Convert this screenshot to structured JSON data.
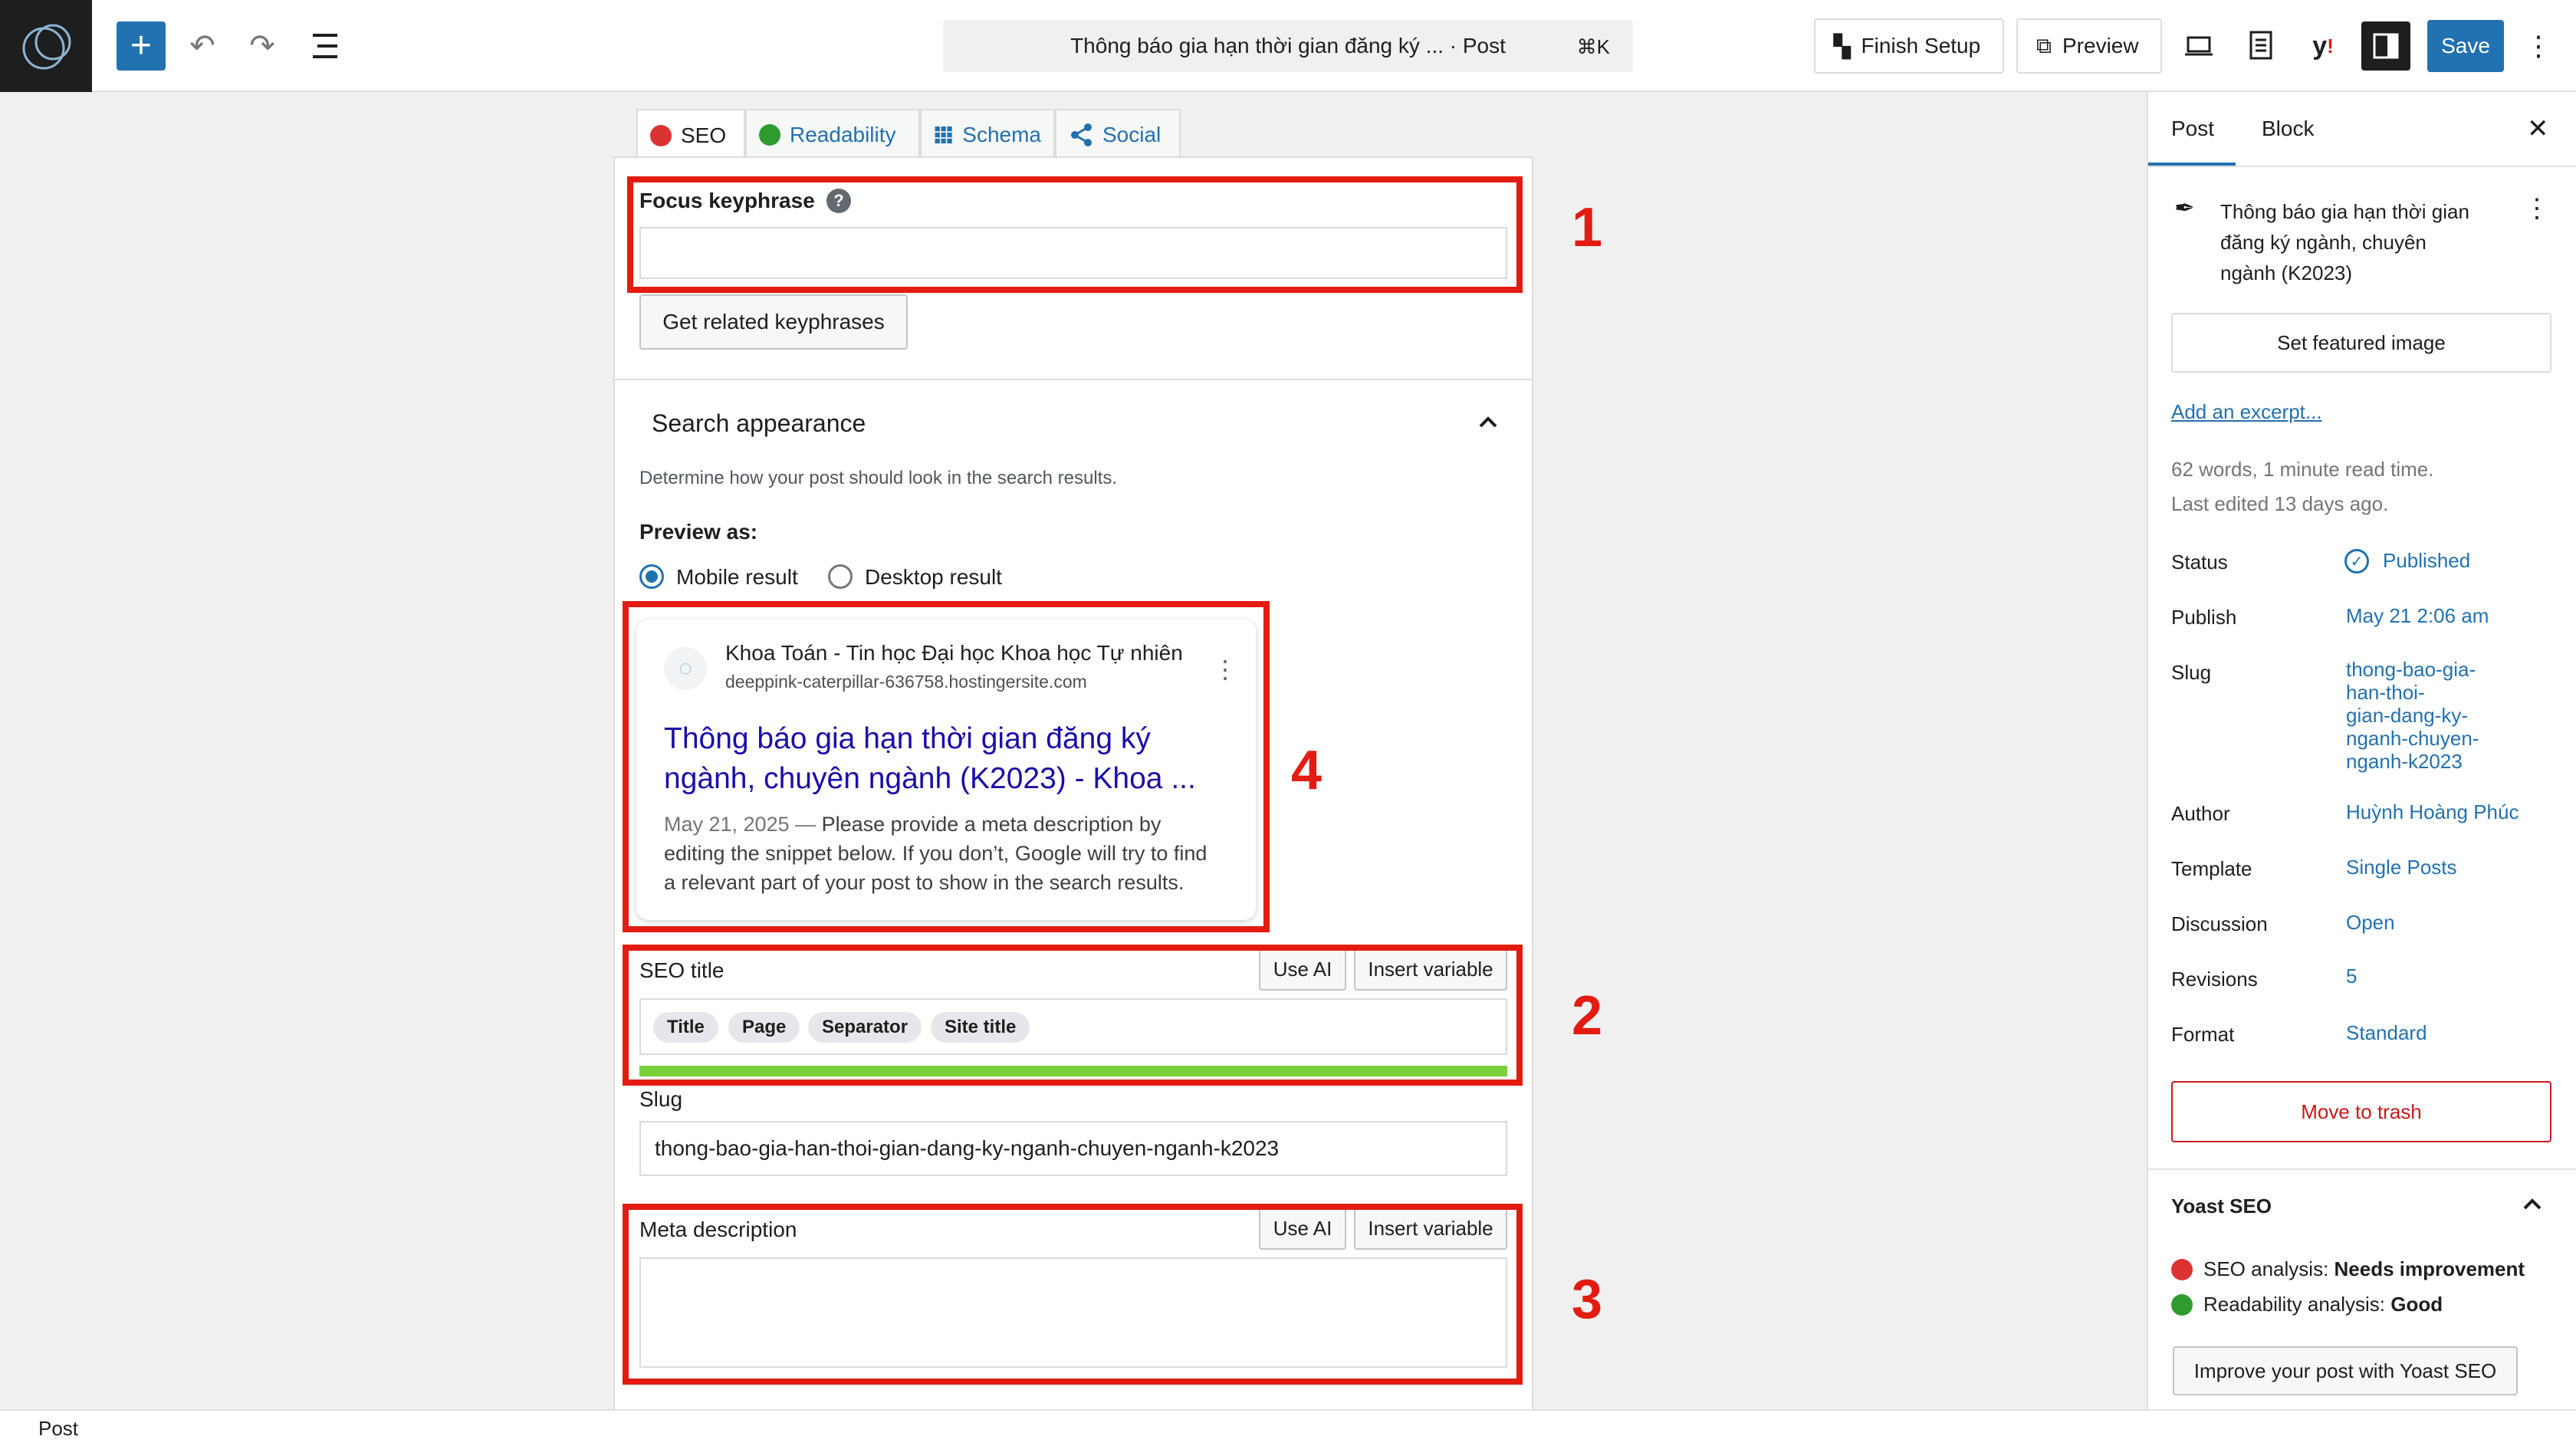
{
  "topbar": {
    "command_title": "Thông báo gia hạn thời gian đăng ký ... · Post",
    "shortcut": "⌘K",
    "finish_setup": "Finish Setup",
    "preview": "Preview",
    "save": "Save"
  },
  "tabs": [
    {
      "label": "SEO"
    },
    {
      "label": "Readability"
    },
    {
      "label": "Schema"
    },
    {
      "label": "Social"
    }
  ],
  "seo": {
    "focus_keyphrase_label": "Focus keyphrase",
    "related_btn": "Get related keyphrases",
    "search_appearance": "Search appearance",
    "search_appearance_desc": "Determine how your post should look in the search results.",
    "preview_as": "Preview as:",
    "mobile_result": "Mobile result",
    "desktop_result": "Desktop result",
    "snippet": {
      "site_name": "Khoa Toán - Tin học Đại học Khoa học Tự nhiên",
      "site_url": "deeppink-caterpillar-636758.hostingersite.com",
      "title_line1": "Thông báo gia hạn thời gian đăng ký",
      "title_line2": "ngành, chuyên ngành (K2023) - Khoa ...",
      "date": "May 21, 2025",
      "desc_line1": "Please provide a meta description by",
      "desc_line2": "editing the snippet below. If you don’t, Google will try to find",
      "desc_line3": "a relevant part of your post to show in the search results."
    },
    "seo_title_label": "SEO title",
    "use_ai": "Use AI",
    "insert_variable": "Insert variable",
    "pills": [
      "Title",
      "Page",
      "Separator",
      "Site title"
    ],
    "slug_label": "Slug",
    "slug_value": "thong-bao-gia-han-thoi-gian-dang-ky-nganh-chuyen-nganh-k2023",
    "meta_description_label": "Meta description"
  },
  "annotations": [
    "1",
    "2",
    "3",
    "4"
  ],
  "sidebar": {
    "tab_post": "Post",
    "tab_block": "Block",
    "post_title_line1": "Thông báo gia hạn thời gian",
    "post_title_line2": "đăng ký ngành, chuyên",
    "post_title_line3": "ngành (K2023)",
    "featured_image": "Set featured image",
    "excerpt": "Add an excerpt...",
    "stats_line1": "62 words, 1 minute read time.",
    "stats_line2": "Last edited 13 days ago.",
    "rows": {
      "status_label": "Status",
      "status_value": "Published",
      "publish_label": "Publish",
      "publish_value": "May 21 2:06 am",
      "slug_label": "Slug",
      "slug_lines": [
        "thong-bao-gia-",
        "han-thoi-",
        "gian-dang-ky-",
        "nganh-chuyen-",
        "nganh-k2023"
      ],
      "author_label": "Author",
      "author_value": "Huỳnh Hoàng Phúc",
      "template_label": "Template",
      "template_value": "Single Posts",
      "discussion_label": "Discussion",
      "discussion_value": "Open",
      "revisions_label": "Revisions",
      "revisions_value": "5",
      "format_label": "Format",
      "format_value": "Standard"
    },
    "trash": "Move to trash",
    "yoast_title": "Yoast SEO",
    "seo_analysis_label": "SEO analysis: ",
    "seo_analysis_value": "Needs improvement",
    "readability_label": "Readability analysis: ",
    "readability_value": "Good",
    "improve_btn": "Improve your post with Yoast SEO"
  },
  "statusbar": {
    "label": "Post"
  },
  "colors": {
    "accent": "#2271b1",
    "annotation": "#e31b10",
    "good": "#2f9b2f",
    "bad": "#dc3232"
  }
}
